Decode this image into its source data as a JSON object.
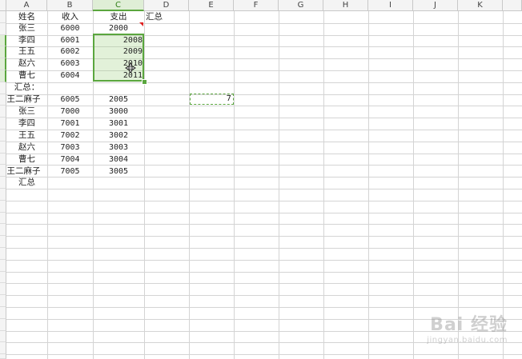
{
  "columns": [
    "A",
    "B",
    "C",
    "D",
    "E",
    "F",
    "G",
    "H",
    "I",
    "J",
    "K"
  ],
  "selected_column": "C",
  "cells": {
    "A1": "姓名",
    "B1": "收入",
    "C1": "支出",
    "D1": "汇总",
    "A2": "张三",
    "B2": "6000",
    "C2": "2000",
    "A3": "李四",
    "B3": "6001",
    "C3": "2008",
    "A4": "王五",
    "B4": "6002",
    "C4": "2009",
    "A5": "赵六",
    "B5": "6003",
    "C5": "2010",
    "A6": "曹七",
    "B6": "6004",
    "C6": "2011",
    "A7": "汇总：",
    "A8": "王二麻子",
    "B8": "6005",
    "C8": "2005",
    "E8": "7",
    "A9": "张三",
    "B9": "7000",
    "C9": "3000",
    "A10": "李四",
    "B10": "7001",
    "C10": "3001",
    "A11": "王五",
    "B11": "7002",
    "C11": "3002",
    "A12": "赵六",
    "B12": "7003",
    "C12": "3003",
    "A13": "曹七",
    "B13": "7004",
    "C13": "3004",
    "A14": "王二麻子",
    "B14": "7005",
    "C14": "3005",
    "A15": "汇总"
  },
  "watermark": {
    "main": "Bai 经验",
    "sub": "jingyan.baidu.com"
  },
  "colors": {
    "selection_border": "#5aa63e",
    "selection_fill": "#dfeed6",
    "comment_marker": "#e02020"
  }
}
